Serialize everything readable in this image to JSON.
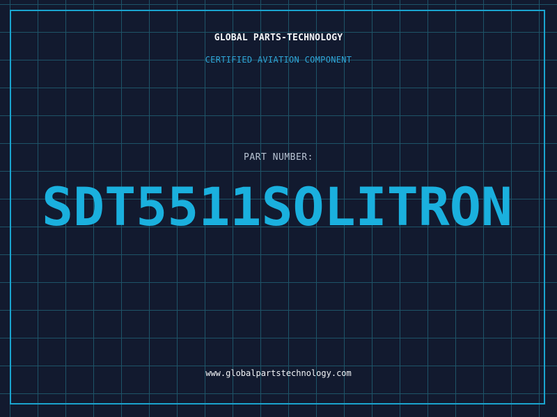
{
  "header": {
    "company": "GLOBAL PARTS-TECHNOLOGY",
    "subtitle": "CERTIFIED AVIATION COMPONENT"
  },
  "part": {
    "label": "PART NUMBER:",
    "number": "SDT5511SOLITRON"
  },
  "footer": {
    "url": "www.globalpartstechnology.com"
  },
  "colors": {
    "background": "#111a2e",
    "grid": "#1e5468",
    "frame": "#1aa4cf",
    "accent": "#1ab0de"
  }
}
